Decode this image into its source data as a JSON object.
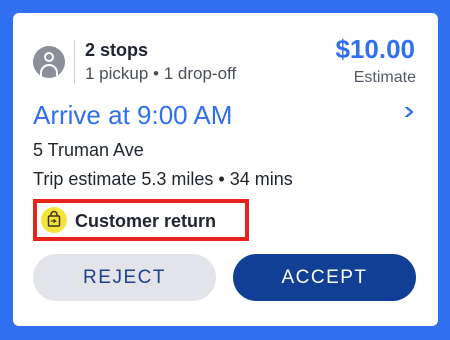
{
  "summary": {
    "stops_title": "2 stops",
    "stops_sub": "1 pickup • 1 drop-off",
    "price": "$10.00",
    "price_note": "Estimate"
  },
  "trip": {
    "arrive": "Arrive at 9:00 AM",
    "address": "5 Truman Ave",
    "estimate": "Trip estimate 5.3 miles • 34 mins"
  },
  "tag": {
    "label": "Customer return",
    "icon": "shopping-bag-return-icon"
  },
  "actions": {
    "reject_label": "REJECT",
    "accept_label": "ACCEPT"
  },
  "colors": {
    "background": "#2f6ff0",
    "accent": "#2f6ff0",
    "accept": "#123f96",
    "highlight": "#e8231b",
    "tag_icon_bg": "#f6e43a"
  }
}
